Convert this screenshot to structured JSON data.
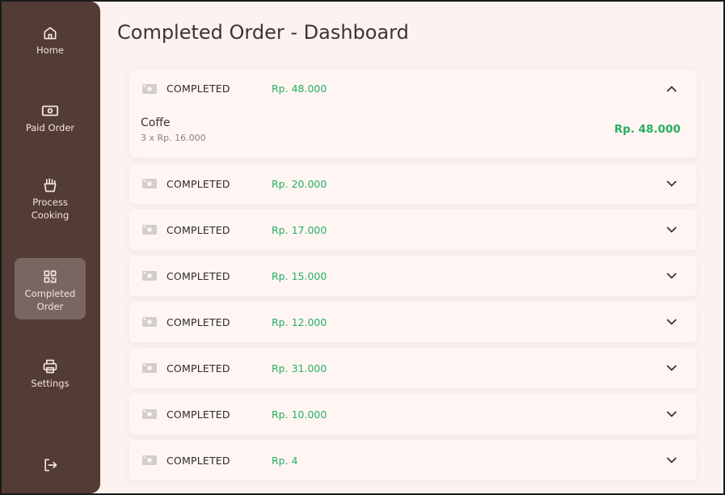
{
  "sidebar": {
    "items": [
      {
        "label": "Home",
        "icon": "home-icon"
      },
      {
        "label": "Paid Order",
        "icon": "money-icon"
      },
      {
        "label": "Process Cooking",
        "icon": "fries-icon"
      },
      {
        "label": "Completed Order",
        "icon": "qr-icon"
      },
      {
        "label": "Settings",
        "icon": "printer-icon"
      }
    ],
    "logout_icon": "logout-icon",
    "active_color": "#7a6660",
    "bg_color": "#533c36"
  },
  "page": {
    "title": "Completed Order - Dashboard"
  },
  "orders": [
    {
      "status": "COMPLETED",
      "amount": "Rp. 48.000",
      "expanded": true,
      "items": [
        {
          "name": "Coffe",
          "qty": "3 x Rp. 16.000",
          "total": "Rp. 48.000"
        }
      ]
    },
    {
      "status": "COMPLETED",
      "amount": "Rp. 20.000"
    },
    {
      "status": "COMPLETED",
      "amount": "Rp. 17.000"
    },
    {
      "status": "COMPLETED",
      "amount": "Rp. 15.000"
    },
    {
      "status": "COMPLETED",
      "amount": "Rp. 12.000"
    },
    {
      "status": "COMPLETED",
      "amount": "Rp. 31.000"
    },
    {
      "status": "COMPLETED",
      "amount": "Rp. 10.000"
    },
    {
      "status": "COMPLETED",
      "amount": "Rp. 4"
    }
  ],
  "colors": {
    "amount": "#27ae60",
    "background": "#fcf2ef"
  }
}
